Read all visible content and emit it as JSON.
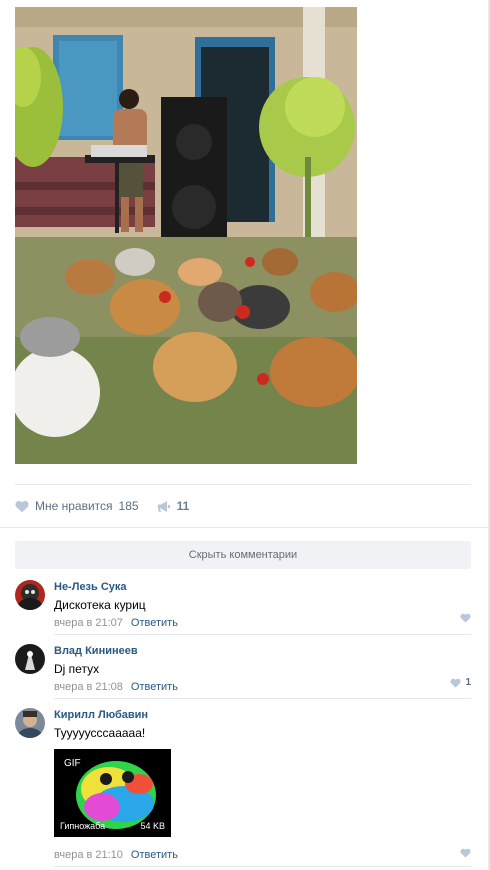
{
  "post": {
    "actions": {
      "like_label": "Мне нравится",
      "like_count": "185",
      "share_count": "11"
    },
    "hide_comments_label": "Скрыть комментарии"
  },
  "comments": [
    {
      "author": "Не-Лезь Сука",
      "text": "Дискотека куриц",
      "time": "вчера в 21:07",
      "reply_label": "Ответить",
      "likes": ""
    },
    {
      "author": "Влад Кининеев",
      "text": "Dj петух",
      "time": "вчера в 21:08",
      "reply_label": "Ответить",
      "likes": "1"
    },
    {
      "author": "Кирилл Любавин",
      "text": "Тууууусссааааа!",
      "time": "вчера в 21:10",
      "reply_label": "Ответить",
      "likes": "",
      "gif": {
        "badge": "GIF",
        "name": "Гипножаба",
        "size": "54 KB"
      }
    }
  ],
  "colors": {
    "link": "#2a5885",
    "action_text": "#5b6f89",
    "meta_text": "#939393",
    "divider": "#e7e8ec",
    "button_bg": "#f0f2f5"
  }
}
